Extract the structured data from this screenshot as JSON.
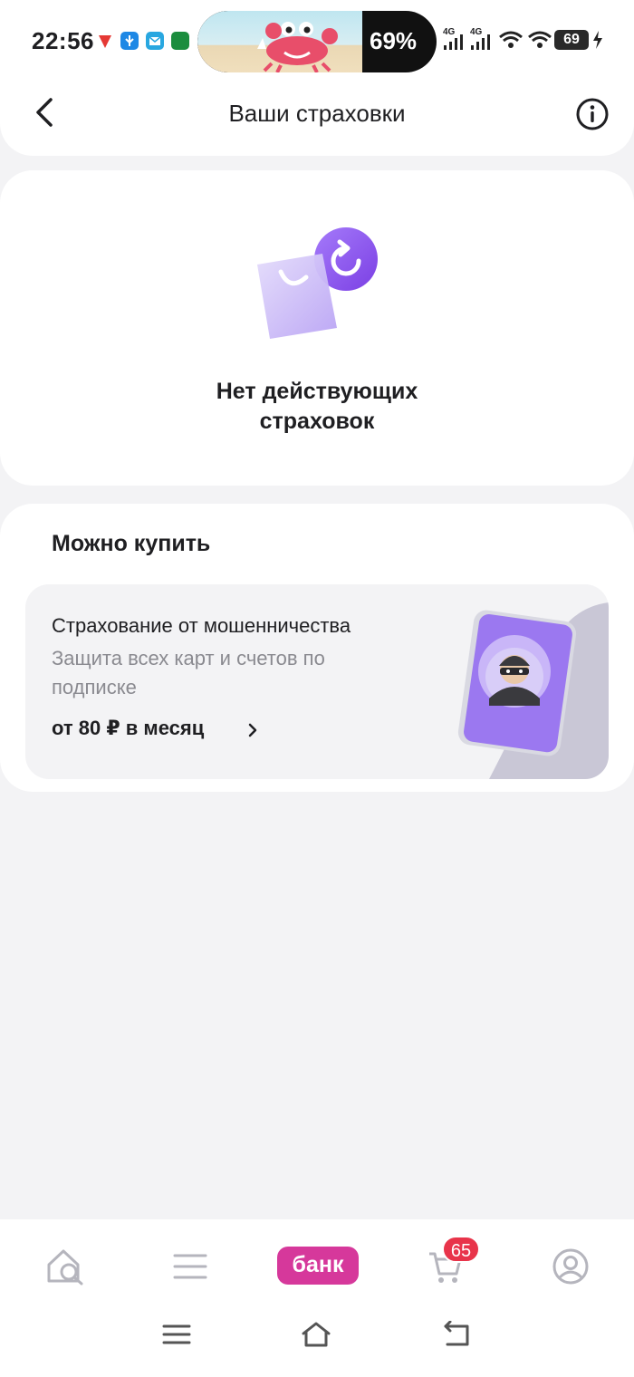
{
  "status_bar": {
    "time": "22:56",
    "island_percent": "69%",
    "network_labels": [
      "4G",
      "4G"
    ],
    "battery": "69"
  },
  "header": {
    "title": "Ваши страховки"
  },
  "empty_state": {
    "text": "Нет действующих страховок"
  },
  "buy_section": {
    "title": "Можно купить",
    "offer": {
      "title": "Страхование от мошенничества",
      "description": "Защита всех карт и счетов по подписке",
      "price": "от 80 ₽ в месяц"
    }
  },
  "tabbar": {
    "bank_label": "банк",
    "cart_badge": "65"
  },
  "colors": {
    "accent": "#d6389b",
    "badge": "#e8344a",
    "purple": "#8a5cf0"
  }
}
